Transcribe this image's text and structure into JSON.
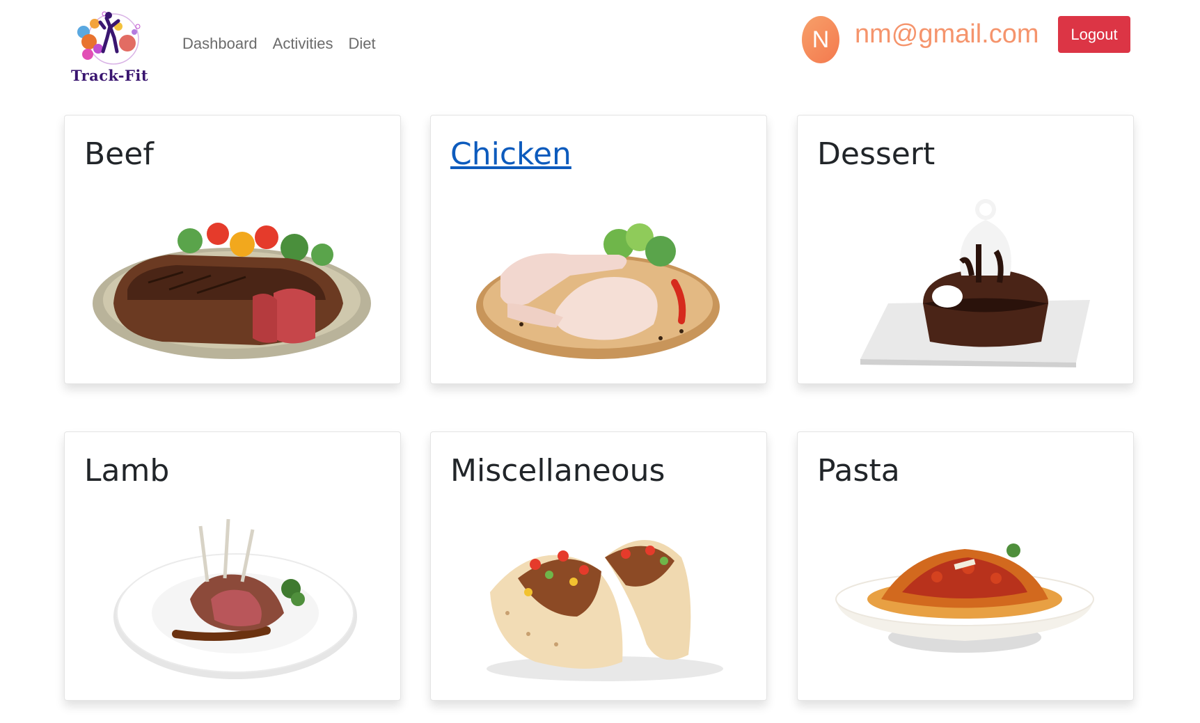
{
  "brand": {
    "name": "Track-Fit"
  },
  "nav": {
    "items": [
      "Dashboard",
      "Activities",
      "Diet"
    ]
  },
  "user": {
    "initial": "N",
    "email": "nm@gmail.com"
  },
  "actions": {
    "logout_label": "Logout"
  },
  "categories": [
    {
      "label": "Beef",
      "image": "beef-image"
    },
    {
      "label": "Chicken",
      "image": "chicken-image"
    },
    {
      "label": "Dessert",
      "image": "dessert-image"
    },
    {
      "label": "Lamb",
      "image": "lamb-image"
    },
    {
      "label": "Miscellaneous",
      "image": "tacos-image"
    },
    {
      "label": "Pasta",
      "image": "pasta-image"
    }
  ],
  "colors": {
    "logout": "#dc3545",
    "email": "#f5946c",
    "link_active": "#0d5bbd",
    "nav_text": "#6b6b6b"
  }
}
